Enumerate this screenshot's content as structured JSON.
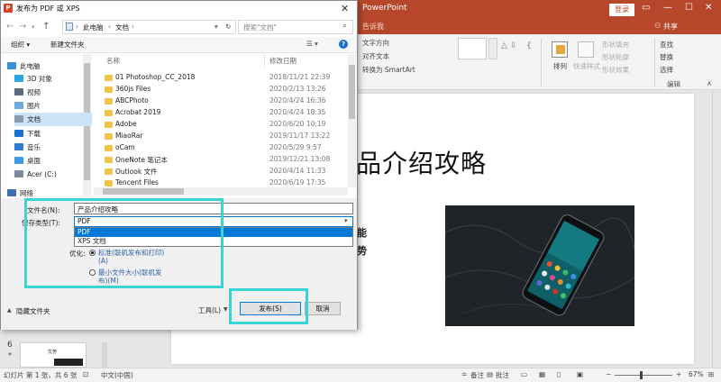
{
  "powerpoint": {
    "title": "PowerPoint",
    "login": "登录",
    "share": "共享",
    "search_tab": "告诉我",
    "ribbon": {
      "text_direction": "文字方向",
      "align_text": "对齐文本",
      "smartart": "转换为 SmartArt",
      "arrange": "排列",
      "quick_styles": "快速样式",
      "shape_fill": "形状填充",
      "shape_outline": "形状轮廓",
      "shape_effects": "形状效果",
      "find": "查找",
      "replace": "替换",
      "select": "选择",
      "group_edit": "编辑"
    },
    "slide": {
      "title": "品介绍攻略",
      "line1": "能",
      "line2": "势"
    },
    "thumb": {
      "number": "6",
      "star": "*",
      "caption": "优势"
    },
    "status": {
      "slide_info": "幻灯片 第 1 张，共 6 张",
      "language": "中文(中国)",
      "notes": "备注",
      "comments": "批注",
      "zoom": "67%"
    }
  },
  "dialog": {
    "title": "发布为 PDF 或 XPS",
    "breadcrumb": [
      "此电脑",
      "文档"
    ],
    "search_placeholder": "搜索\"文档\"",
    "toolbar": {
      "organize": "组织 ▾",
      "new_folder": "新建文件夹"
    },
    "sidebar": [
      {
        "label": "此电脑",
        "color": "#3b8fd6"
      },
      {
        "label": "3D 对象",
        "color": "#2ba7e0"
      },
      {
        "label": "视频",
        "color": "#5a6d7f"
      },
      {
        "label": "图片",
        "color": "#6fa8dc"
      },
      {
        "label": "文档",
        "color": "#8a9bb0",
        "selected": true
      },
      {
        "label": "下载",
        "color": "#1a73c9"
      },
      {
        "label": "音乐",
        "color": "#2f7bd1"
      },
      {
        "label": "桌面",
        "color": "#3e9be0"
      },
      {
        "label": "Acer (C:)",
        "color": "#7d8a99"
      },
      {
        "label": "网络",
        "color": "#3b6fb0"
      }
    ],
    "columns": {
      "name": "名称",
      "date": "修改日期"
    },
    "files": [
      {
        "name": "01 Photoshop_CC_2018",
        "date": "2018/11/21 22:39"
      },
      {
        "name": "360js Files",
        "date": "2020/2/13 13:26"
      },
      {
        "name": "ABCPhoto",
        "date": "2020/4/24 16:36"
      },
      {
        "name": "Acrobat 2019",
        "date": "2020/4/24 18:35"
      },
      {
        "name": "Adobe",
        "date": "2020/6/20 10:19"
      },
      {
        "name": "MiaoRar",
        "date": "2019/11/17 13:22"
      },
      {
        "name": "oCam",
        "date": "2020/5/29 9:57"
      },
      {
        "name": "OneNote 笔记本",
        "date": "2019/12/21 13:08"
      },
      {
        "name": "Outlook 文件",
        "date": "2020/4/14 11:33"
      },
      {
        "name": "Tencent Files",
        "date": "2020/6/19 17:35"
      }
    ],
    "form": {
      "filename_label": "文件名(N):",
      "filename_value": "产品介绍攻略",
      "filetype_label": "保存类型(T):",
      "filetype_value": "PDF",
      "filetype_options": [
        "PDF",
        "XPS 文档"
      ],
      "optimize_label": "优化:",
      "opt_standard_1": "标准(联机发布和打印)",
      "opt_standard_2": "(A)",
      "opt_min_1": "最小文件大小(联机发",
      "opt_min_2": "布)(M)"
    },
    "hide_folders": "隐藏文件夹",
    "buttons": {
      "tools": "工具(L)",
      "publish": "发布(S)",
      "cancel": "取消"
    }
  }
}
